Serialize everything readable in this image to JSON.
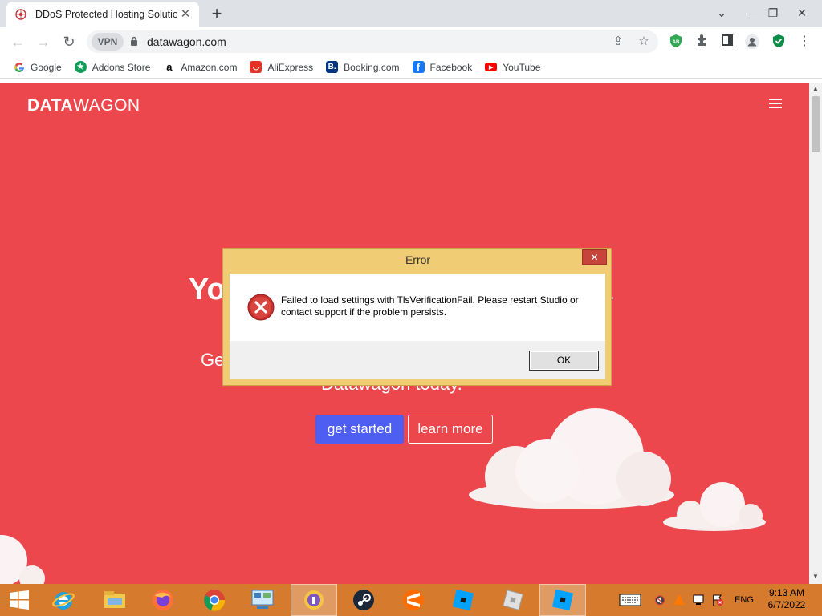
{
  "browser": {
    "tab_title": "DDoS Protected Hosting Solution",
    "tab_close": "✕",
    "new_tab": "+",
    "url": "datawagon.com",
    "vpn_label": "VPN",
    "extension_ab": "AB"
  },
  "bookmarks": [
    {
      "label": "Google",
      "icon": "google-icon",
      "color": "#ffffff"
    },
    {
      "label": "Addons Store",
      "icon": "addons-store-icon",
      "color": "#0f9d58"
    },
    {
      "label": "Amazon.com",
      "icon": "amazon-icon",
      "color": "#ffffff"
    },
    {
      "label": "AliExpress",
      "icon": "aliexpress-icon",
      "color": "#e43225"
    },
    {
      "label": "Booking.com",
      "icon": "booking-icon",
      "color": "#003580"
    },
    {
      "label": "Facebook",
      "icon": "facebook-icon",
      "color": "#1877f2"
    },
    {
      "label": "YouTube",
      "icon": "youtube-icon",
      "color": "#ff0000"
    }
  ],
  "page": {
    "logo_bold": "DATA",
    "logo_light": "WAGON",
    "hero_title_head": "Yo",
    "hero_title_tail": "a",
    "hero_sub_line1": "Ge",
    "hero_sub_line2": "Datawagon today.",
    "get_started": "get started",
    "learn_more": "learn more",
    "background_color": "#ec474c"
  },
  "dialog": {
    "title": "Error",
    "close": "✕",
    "message": "Failed to load settings with TlsVerificationFail. Please restart Studio or contact support if the problem persists.",
    "ok": "OK"
  },
  "taskbar": {
    "language": "ENG",
    "time": "9:13 AM",
    "date": "6/7/2022",
    "apps": [
      "internet-explorer-icon",
      "file-explorer-icon",
      "firefox-icon",
      "chrome-icon",
      "control-panel-icon",
      "keepass-icon",
      "steam-icon",
      "sublime-icon",
      "roblox-studio-icon",
      "roblox-icon",
      "roblox-studio-active-icon"
    ]
  }
}
